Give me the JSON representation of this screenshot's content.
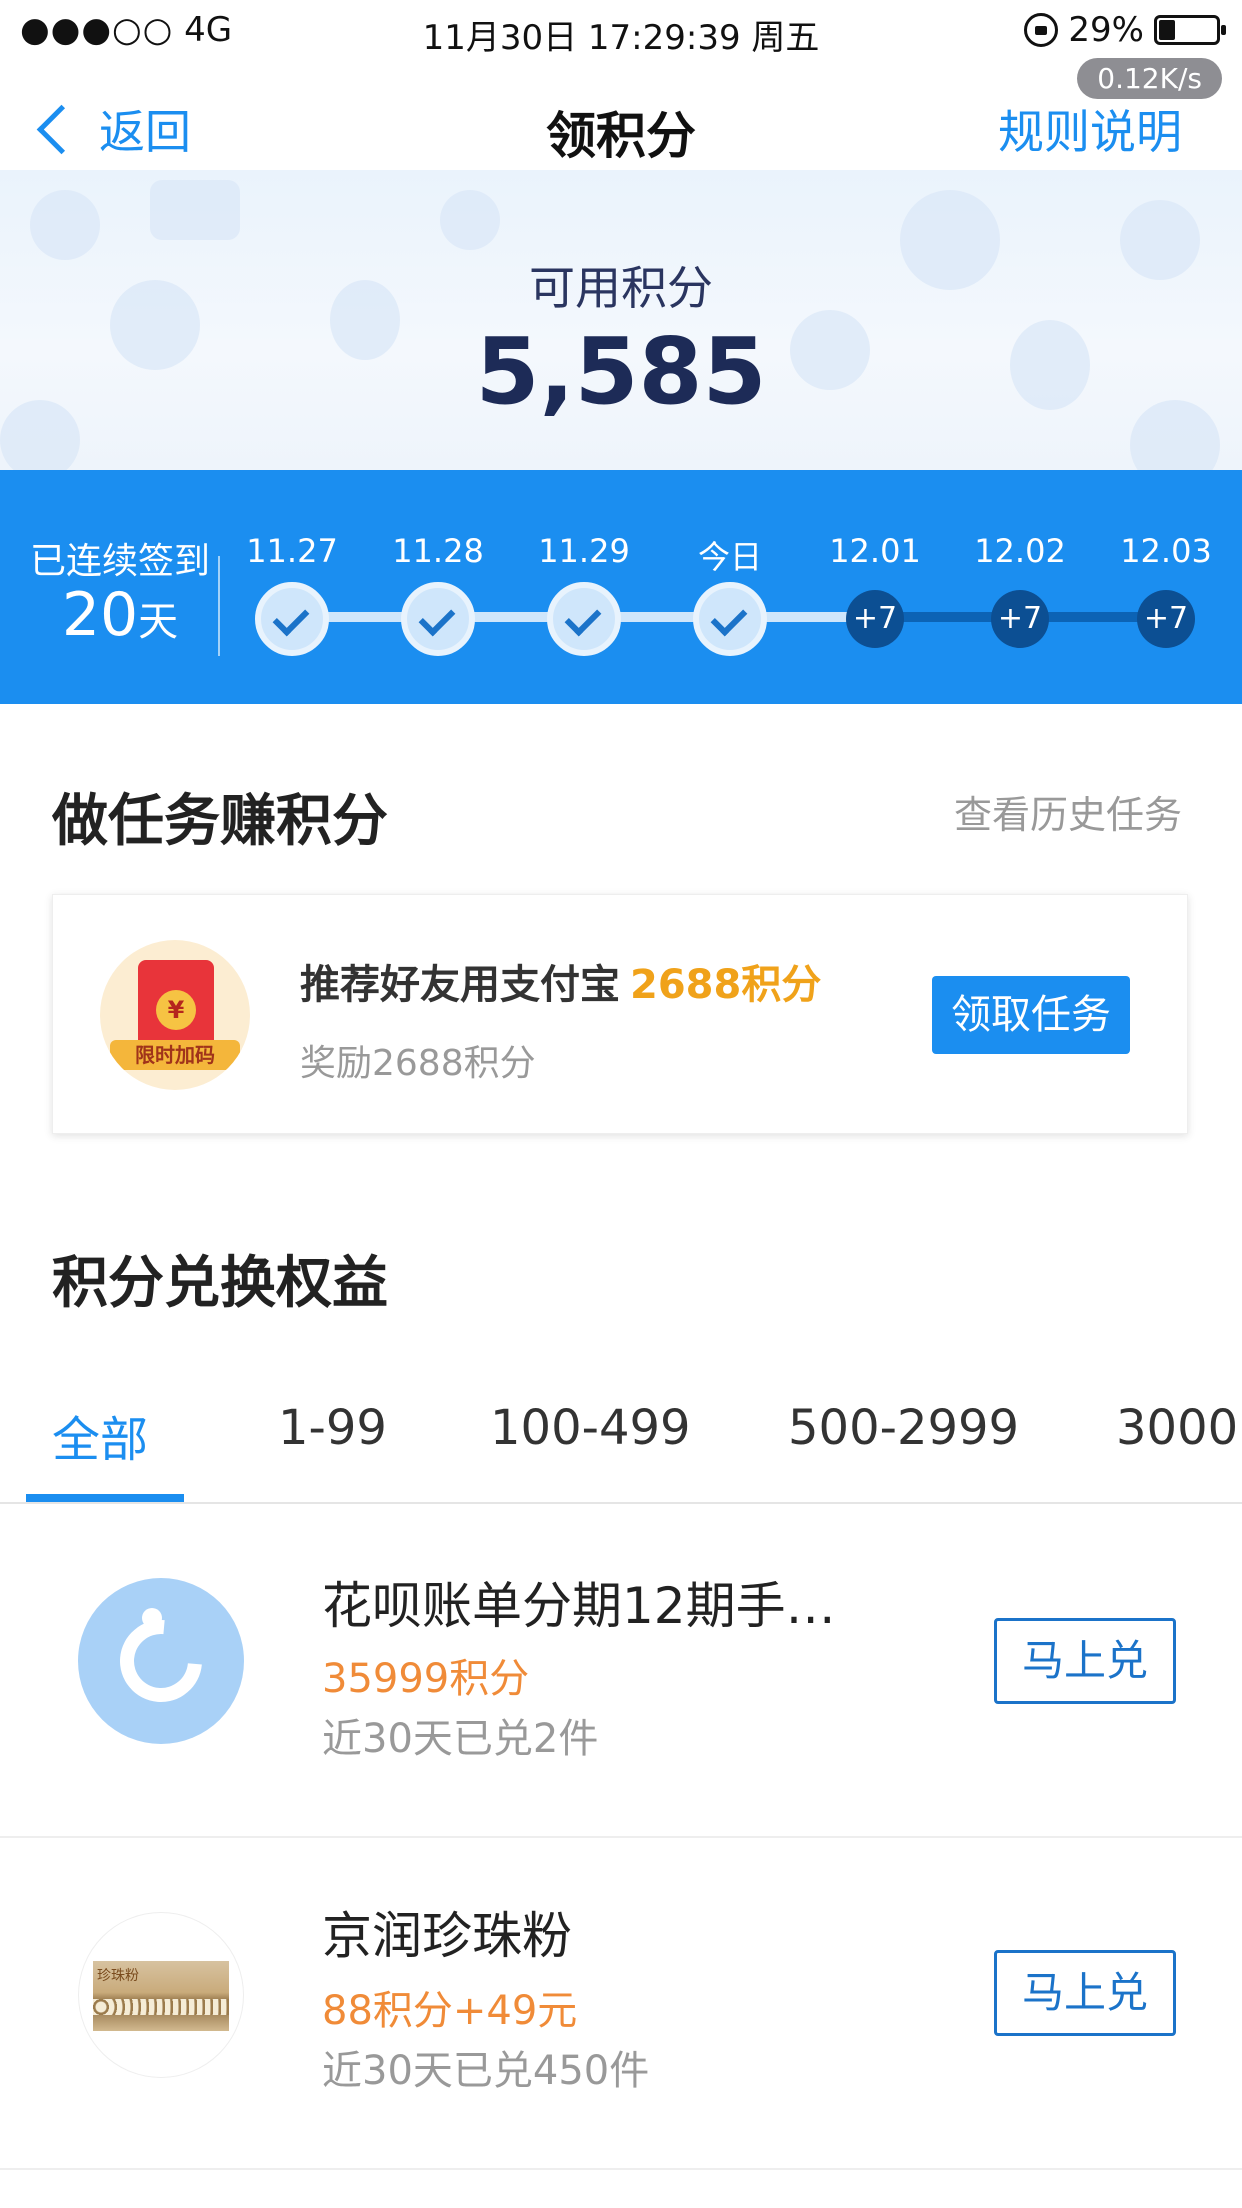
{
  "status_bar": {
    "signal": "●●●○○",
    "network": "4G",
    "datetime": "11月30日 17:29:39 周五",
    "battery": "29%",
    "battery_level": 0.29,
    "net_speed": "0.12K/s"
  },
  "nav": {
    "back": "返回",
    "title": "领积分",
    "rules": "规则说明"
  },
  "points": {
    "label": "可用积分",
    "value": "5,585"
  },
  "checkin": {
    "streak_label": "已连续签到",
    "streak_days": "20",
    "streak_unit": "天",
    "days": [
      {
        "label": "11.27",
        "done": true
      },
      {
        "label": "11.28",
        "done": true
      },
      {
        "label": "11.29",
        "done": true
      },
      {
        "label": "今日",
        "done": true
      },
      {
        "label": "12.01",
        "done": false,
        "bonus": "+7"
      },
      {
        "label": "12.02",
        "done": false,
        "bonus": "+7"
      },
      {
        "label": "12.03",
        "done": false,
        "bonus": "+7"
      }
    ]
  },
  "tasks": {
    "title": "做任务赚积分",
    "history": "查看历史任务",
    "card": {
      "icon": "red-envelope-icon",
      "badge": "限时加码",
      "coin": "¥",
      "name": "推荐好友用支付宝",
      "points": "2688积分",
      "desc": "奖励2688积分",
      "button": "领取任务"
    }
  },
  "exchange": {
    "title": "积分兑换权益",
    "tabs": [
      "全部",
      "1-99",
      "100-499",
      "500-2999",
      "3000"
    ],
    "active_tab": 0,
    "items": [
      {
        "icon": "huabei-logo",
        "title": "花呗账单分期12期手…",
        "price": "35999积分",
        "count": "近30天已兑2件",
        "button": "马上兑"
      },
      {
        "icon": "pearl-powder-box",
        "brand": "珍珠粉",
        "title": "京润珍珠粉",
        "price": "88积分+49元",
        "count": "近30天已兑450件",
        "button": "马上兑"
      }
    ]
  },
  "colors": {
    "accent": "#1b8ef0",
    "points_highlight": "#f0a21a",
    "price": "#f08b38"
  }
}
